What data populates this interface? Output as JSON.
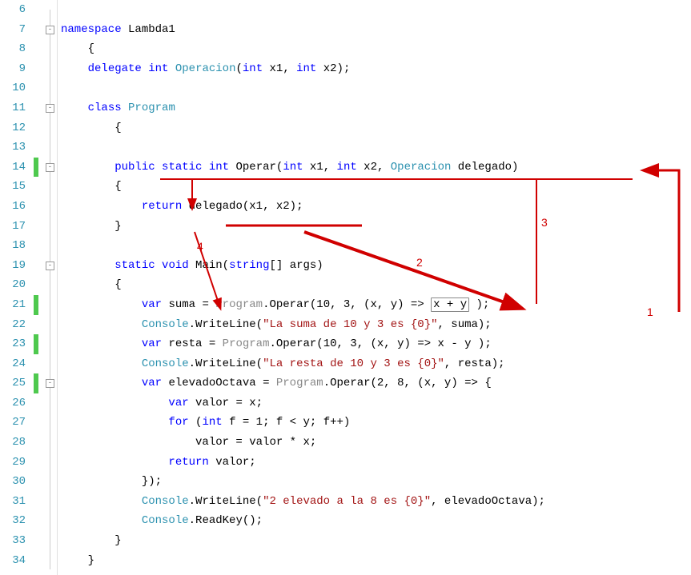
{
  "lines": [
    {
      "n": "6",
      "mark": false,
      "fold": null,
      "tokens": []
    },
    {
      "n": "7",
      "mark": false,
      "fold": "minus",
      "tokens": [
        {
          "t": "namespace",
          "c": "kw"
        },
        {
          "t": " Lambda1"
        }
      ]
    },
    {
      "n": "8",
      "mark": false,
      "fold": null,
      "tokens": [
        {
          "t": "    {"
        }
      ]
    },
    {
      "n": "9",
      "mark": false,
      "fold": null,
      "tokens": [
        {
          "t": "    "
        },
        {
          "t": "delegate",
          "c": "kw"
        },
        {
          "t": " "
        },
        {
          "t": "int",
          "c": "kw"
        },
        {
          "t": " "
        },
        {
          "t": "Operacion",
          "c": "type"
        },
        {
          "t": "("
        },
        {
          "t": "int",
          "c": "kw"
        },
        {
          "t": " x1, "
        },
        {
          "t": "int",
          "c": "kw"
        },
        {
          "t": " x2);"
        }
      ]
    },
    {
      "n": "10",
      "mark": false,
      "fold": null,
      "tokens": []
    },
    {
      "n": "11",
      "mark": false,
      "fold": "minus",
      "tokens": [
        {
          "t": "    "
        },
        {
          "t": "class",
          "c": "kw"
        },
        {
          "t": " "
        },
        {
          "t": "Program",
          "c": "type"
        }
      ]
    },
    {
      "n": "12",
      "mark": false,
      "fold": null,
      "tokens": [
        {
          "t": "        {"
        }
      ]
    },
    {
      "n": "13",
      "mark": false,
      "fold": null,
      "tokens": []
    },
    {
      "n": "14",
      "mark": true,
      "fold": "minus",
      "tokens": [
        {
          "t": "        "
        },
        {
          "t": "public",
          "c": "kw"
        },
        {
          "t": " "
        },
        {
          "t": "static",
          "c": "kw"
        },
        {
          "t": " "
        },
        {
          "t": "int",
          "c": "kw"
        },
        {
          "t": " Operar("
        },
        {
          "t": "int",
          "c": "kw"
        },
        {
          "t": " x1, "
        },
        {
          "t": "int",
          "c": "kw"
        },
        {
          "t": " x2, "
        },
        {
          "t": "Operacion",
          "c": "type"
        },
        {
          "t": " delegado)"
        }
      ]
    },
    {
      "n": "15",
      "mark": false,
      "fold": null,
      "tokens": [
        {
          "t": "        {"
        }
      ]
    },
    {
      "n": "16",
      "mark": false,
      "fold": null,
      "tokens": [
        {
          "t": "            "
        },
        {
          "t": "return",
          "c": "kw"
        },
        {
          "t": " delegado(x1, x2);"
        }
      ]
    },
    {
      "n": "17",
      "mark": false,
      "fold": null,
      "tokens": [
        {
          "t": "        }"
        }
      ]
    },
    {
      "n": "18",
      "mark": false,
      "fold": null,
      "tokens": []
    },
    {
      "n": "19",
      "mark": false,
      "fold": "minus",
      "tokens": [
        {
          "t": "        "
        },
        {
          "t": "static",
          "c": "kw"
        },
        {
          "t": " "
        },
        {
          "t": "void",
          "c": "kw"
        },
        {
          "t": " Main("
        },
        {
          "t": "string",
          "c": "kw"
        },
        {
          "t": "[] args)"
        }
      ]
    },
    {
      "n": "20",
      "mark": false,
      "fold": null,
      "tokens": [
        {
          "t": "        {"
        }
      ]
    },
    {
      "n": "21",
      "mark": true,
      "fold": null,
      "tokens": [
        {
          "t": "            "
        },
        {
          "t": "var",
          "c": "kw"
        },
        {
          "t": " suma = "
        },
        {
          "t": "Program",
          "c": "gray"
        },
        {
          "t": ".Operar(10, 3, (x, y) => "
        },
        {
          "t": "x + y",
          "boxed": true
        },
        {
          "t": " );"
        }
      ]
    },
    {
      "n": "22",
      "mark": false,
      "fold": null,
      "tokens": [
        {
          "t": "            "
        },
        {
          "t": "Console",
          "c": "type"
        },
        {
          "t": ".WriteLine("
        },
        {
          "t": "\"La suma de 10 y 3 es {0}\"",
          "c": "str"
        },
        {
          "t": ", suma);"
        }
      ]
    },
    {
      "n": "23",
      "mark": true,
      "fold": null,
      "tokens": [
        {
          "t": "            "
        },
        {
          "t": "var",
          "c": "kw"
        },
        {
          "t": " resta = "
        },
        {
          "t": "Program",
          "c": "gray"
        },
        {
          "t": ".Operar(10, 3, (x, y) => x - y );"
        }
      ]
    },
    {
      "n": "24",
      "mark": false,
      "fold": null,
      "tokens": [
        {
          "t": "            "
        },
        {
          "t": "Console",
          "c": "type"
        },
        {
          "t": ".WriteLine("
        },
        {
          "t": "\"La resta de 10 y 3 es {0}\"",
          "c": "str"
        },
        {
          "t": ", resta);"
        }
      ]
    },
    {
      "n": "25",
      "mark": true,
      "fold": "minus",
      "tokens": [
        {
          "t": "            "
        },
        {
          "t": "var",
          "c": "kw"
        },
        {
          "t": " elevadoOctava = "
        },
        {
          "t": "Program",
          "c": "gray"
        },
        {
          "t": ".Operar(2, 8, (x, y) => {"
        }
      ]
    },
    {
      "n": "26",
      "mark": false,
      "fold": null,
      "tokens": [
        {
          "t": "                "
        },
        {
          "t": "var",
          "c": "kw"
        },
        {
          "t": " valor = x;"
        }
      ]
    },
    {
      "n": "27",
      "mark": false,
      "fold": null,
      "tokens": [
        {
          "t": "                "
        },
        {
          "t": "for",
          "c": "kw"
        },
        {
          "t": " ("
        },
        {
          "t": "int",
          "c": "kw"
        },
        {
          "t": " f = 1; f < y; f++)"
        }
      ]
    },
    {
      "n": "28",
      "mark": false,
      "fold": null,
      "tokens": [
        {
          "t": "                    valor = valor * x;"
        }
      ]
    },
    {
      "n": "29",
      "mark": false,
      "fold": null,
      "tokens": [
        {
          "t": "                "
        },
        {
          "t": "return",
          "c": "kw"
        },
        {
          "t": " valor;"
        }
      ]
    },
    {
      "n": "30",
      "mark": false,
      "fold": null,
      "tokens": [
        {
          "t": "            });"
        }
      ]
    },
    {
      "n": "31",
      "mark": false,
      "fold": null,
      "tokens": [
        {
          "t": "            "
        },
        {
          "t": "Console",
          "c": "type"
        },
        {
          "t": ".WriteLine("
        },
        {
          "t": "\"2 elevado a la 8 es {0}\"",
          "c": "str"
        },
        {
          "t": ", elevadoOctava);"
        }
      ]
    },
    {
      "n": "32",
      "mark": false,
      "fold": null,
      "tokens": [
        {
          "t": "            "
        },
        {
          "t": "Console",
          "c": "type"
        },
        {
          "t": ".ReadKey();"
        }
      ]
    },
    {
      "n": "33",
      "mark": false,
      "fold": null,
      "tokens": [
        {
          "t": "        }"
        }
      ]
    },
    {
      "n": "34",
      "mark": false,
      "fold": null,
      "tokens": [
        {
          "t": "    }"
        }
      ]
    }
  ],
  "annotations": {
    "labels": {
      "a1": "1",
      "a2": "2",
      "a3": "3",
      "a4": "4"
    }
  }
}
